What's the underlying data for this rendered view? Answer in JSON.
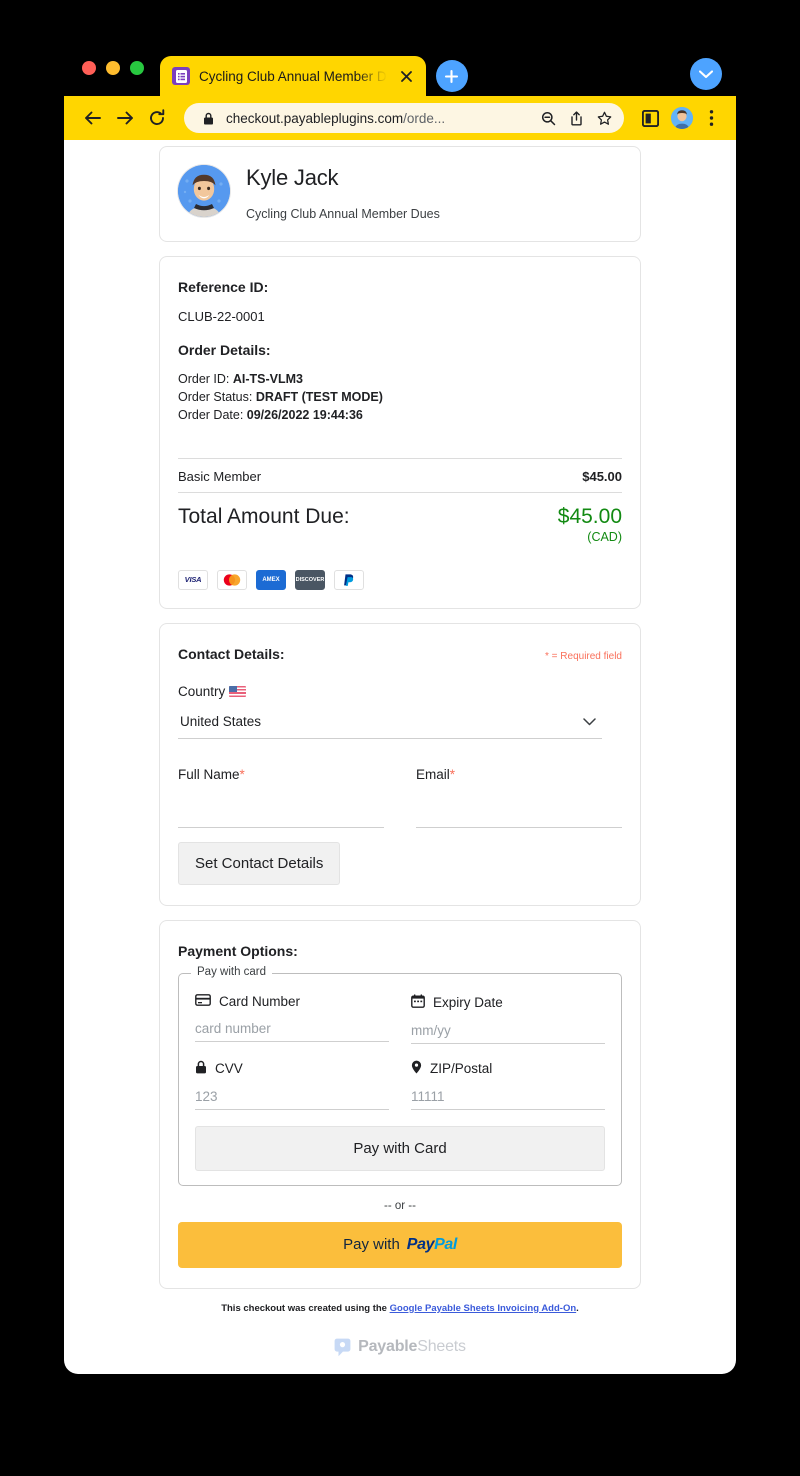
{
  "browser": {
    "traffic_lights": [
      "close",
      "minimize",
      "zoom"
    ],
    "tab": {
      "favicon": "google-forms-icon",
      "title": "Cycling Club Annual Member D",
      "close_label": "✕"
    },
    "new_tab_label": "+",
    "tab_list_label": "⌄",
    "toolbar": {
      "back_label": "←",
      "forward_label": "→",
      "reload_label": "↻",
      "lock_icon": "padlock-icon",
      "url_main": "checkout.payableplugins.com",
      "url_path": "/orde...",
      "zoom_out_icon": "zoom-out-icon",
      "share_icon": "share-icon",
      "bookmark_icon": "star-icon",
      "sidepanel_icon": "side-panel-icon",
      "profile_icon": "avatar-icon",
      "menu_icon": "three-dot-menu-icon"
    }
  },
  "profile": {
    "avatar": "user-avatar",
    "name": "Kyle Jack",
    "subtitle": "Cycling Club Annual Member Dues"
  },
  "order": {
    "reference_heading": "Reference ID:",
    "reference_value": "CLUB-22-0001",
    "details_heading": "Order Details:",
    "order_id_label": "Order ID: ",
    "order_id_value": "AI-TS-VLM3",
    "order_status_label": "Order Status: ",
    "order_status_value": "DRAFT (TEST MODE)",
    "order_date_label": "Order Date: ",
    "order_date_value": "09/26/2022 19:44:36",
    "line_item_name": "Basic Member",
    "line_item_amount": "$45.00",
    "total_label": "Total Amount Due:",
    "total_amount": "$45.00",
    "total_currency": "(CAD)",
    "total_color": "#128a12",
    "card_brands": [
      {
        "name": "visa-icon",
        "label": "VISA"
      },
      {
        "name": "mastercard-icon",
        "label": ""
      },
      {
        "name": "amex-icon",
        "label": "AMEX"
      },
      {
        "name": "discover-icon",
        "label": "DISCOVER"
      },
      {
        "name": "paypal-icon",
        "label": ""
      }
    ]
  },
  "contact": {
    "heading": "Contact Details:",
    "required_note": "* = Required field",
    "required_note_color": "#f9705b",
    "country_label": "Country",
    "country_flag": "us-flag-icon",
    "country_value": "United States",
    "full_name_label": "Full Name",
    "full_name_value": "",
    "email_label": "Email",
    "email_value": "",
    "required_star": "*",
    "set_contact_button": "Set Contact Details"
  },
  "payment": {
    "heading": "Payment Options:",
    "card_fieldset_legend": "Pay with card",
    "card_number_label": "Card Number",
    "card_number_icon": "credit-card-icon",
    "card_number_placeholder": "card number",
    "expiry_label": "Expiry Date",
    "expiry_icon": "calendar-icon",
    "expiry_placeholder": "mm/yy",
    "cvv_label": "CVV",
    "cvv_icon": "lock-icon",
    "cvv_placeholder": "123",
    "zip_label": "ZIP/Postal",
    "zip_icon": "location-pin-icon",
    "zip_placeholder": "11111",
    "pay_with_card_button": "Pay with Card",
    "or_divider": "-- or --",
    "paypal_button_prefix": "Pay with",
    "paypal_logo_pay": "Pay",
    "paypal_logo_pal": "Pal",
    "paypal_button_color": "#fbbe3c"
  },
  "footer": {
    "text_before": "This checkout was created using the ",
    "link_text": "Google Payable Sheets Invoicing Add-On",
    "text_after": ".",
    "logo_mark": "payable-sheets-logo",
    "logo_bold": "Payable",
    "logo_light": "Sheets"
  }
}
